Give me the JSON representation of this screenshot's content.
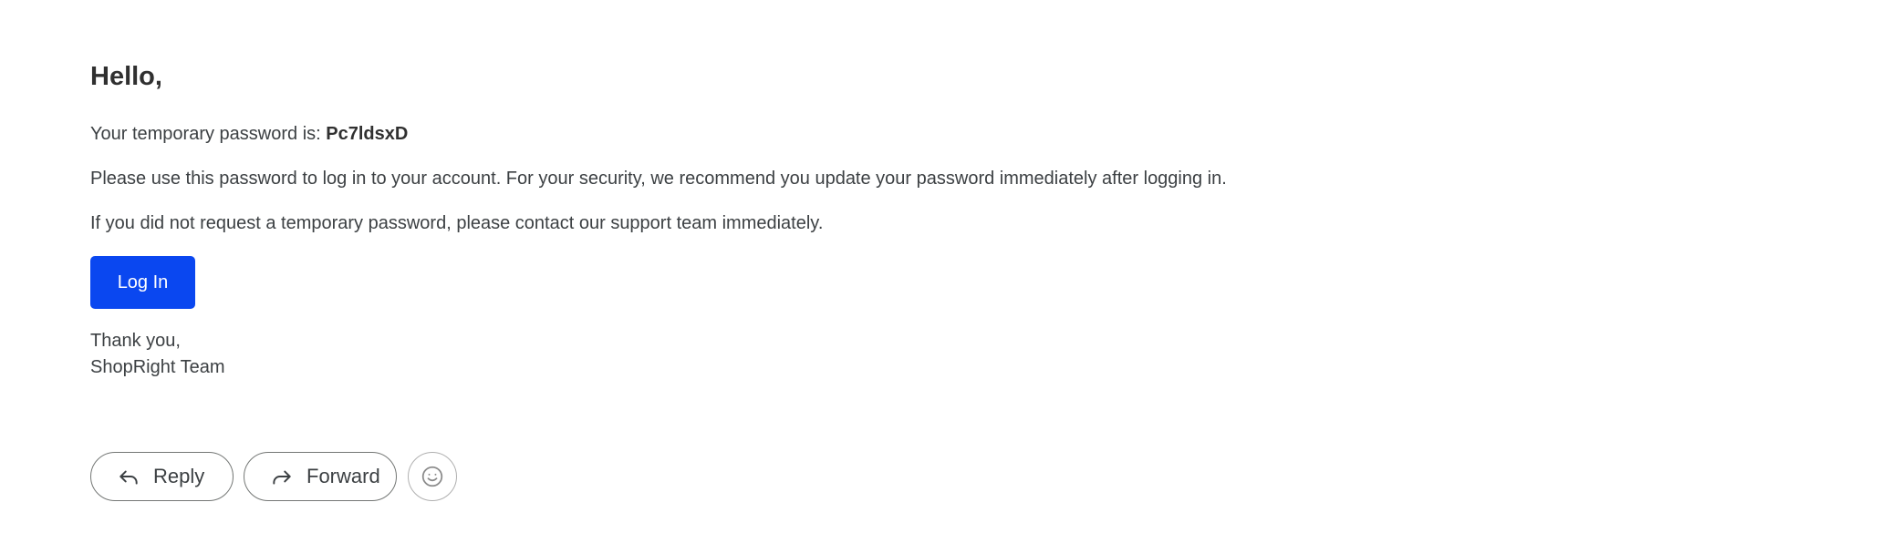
{
  "email": {
    "greeting": "Hello,",
    "password_prefix": "Your temporary password is: ",
    "password_value": "Pc7ldsxD",
    "instruction": "Please use this password to log in to your account. For your security, we recommend you update your password immediately after logging in.",
    "warning": "If you did not request a temporary password, please contact our support team immediately.",
    "login_button": "Log In",
    "signoff_line1": "Thank you,",
    "signoff_line2": "ShopRight Team",
    "accent_color": "#0a47f0"
  },
  "actions": {
    "reply_label": "Reply",
    "reply_icon": "reply-icon",
    "forward_label": "Forward",
    "forward_icon": "forward-icon",
    "emoji_icon": "emoji-icon"
  }
}
